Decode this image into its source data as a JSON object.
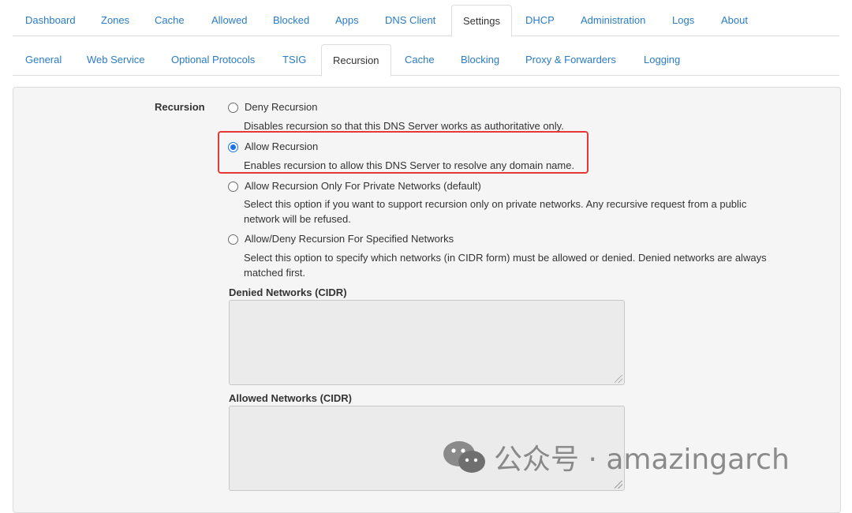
{
  "main_tabs": [
    "Dashboard",
    "Zones",
    "Cache",
    "Allowed",
    "Blocked",
    "Apps",
    "DNS Client",
    "Settings",
    "DHCP",
    "Administration",
    "Logs",
    "About"
  ],
  "main_active": "Settings",
  "sub_tabs": [
    "General",
    "Web Service",
    "Optional Protocols",
    "TSIG",
    "Recursion",
    "Cache",
    "Blocking",
    "Proxy & Forwarders",
    "Logging"
  ],
  "sub_active": "Recursion",
  "recursion": {
    "label": "Recursion",
    "selected": "allow",
    "options": [
      {
        "id": "deny",
        "title": "Deny Recursion",
        "description": "Disables recursion so that this DNS Server works as authoritative only."
      },
      {
        "id": "allow",
        "title": "Allow Recursion",
        "description": "Enables recursion to allow this DNS Server to resolve any domain name."
      },
      {
        "id": "private",
        "title": "Allow Recursion Only For Private Networks (default)",
        "description": "Select this option if you want to support recursion only on private networks. Any recursive request from a public network will be refused."
      },
      {
        "id": "specified",
        "title": "Allow/Deny Recursion For Specified Networks",
        "description": "Select this option to specify which networks (in CIDR form) must be allowed or denied. Denied networks are always matched first."
      }
    ],
    "denied_networks_label": "Denied Networks (CIDR)",
    "denied_networks_value": "",
    "allowed_networks_label": "Allowed Networks (CIDR)",
    "allowed_networks_value": ""
  },
  "highlight_color": "#e53935",
  "accent_color": "#2a7cc5",
  "watermark": {
    "text": "公众号 · amazingarch",
    "icon": "wechat-logo-icon"
  }
}
